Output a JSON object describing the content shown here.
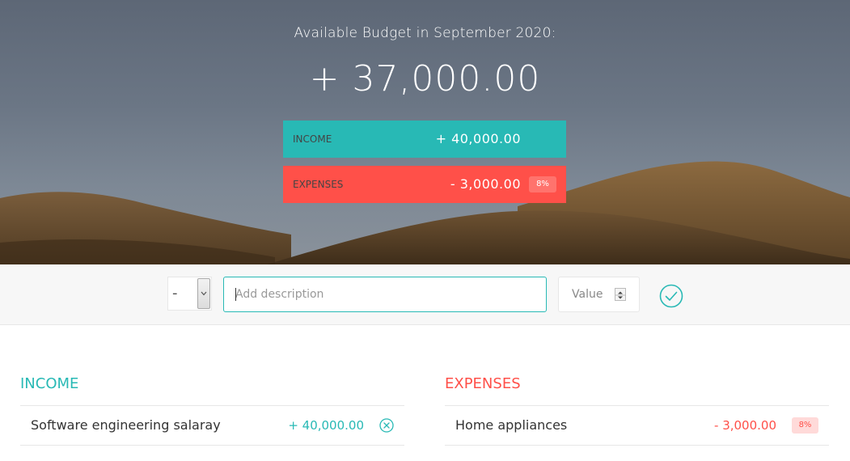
{
  "budget": {
    "title": "Available Budget in September 2020:",
    "value": "+ 37,000.00",
    "income_label": "Income",
    "income_value": "+ 40,000.00",
    "expenses_label": "Expenses",
    "expenses_value": "- 3,000.00",
    "expenses_percentage": "8%"
  },
  "add": {
    "type_selected": "-",
    "description_placeholder": "Add description",
    "value_placeholder": "Value",
    "submit_icon": "checkmark-circle-icon"
  },
  "income": {
    "title": "Income",
    "items": [
      {
        "description": "Software engineering salaray",
        "value": "+ 40,000.00",
        "delete_icon": "close-circle-icon"
      }
    ]
  },
  "expenses": {
    "title": "Expenses",
    "items": [
      {
        "description": "Home appliances",
        "value": "- 3,000.00",
        "percentage": "8%"
      }
    ]
  },
  "colors": {
    "income": "#28b9b5",
    "expenses": "#ff5049",
    "pct_badge_bg": "#ffdad9",
    "add_bar_bg": "#f7f7f7"
  }
}
